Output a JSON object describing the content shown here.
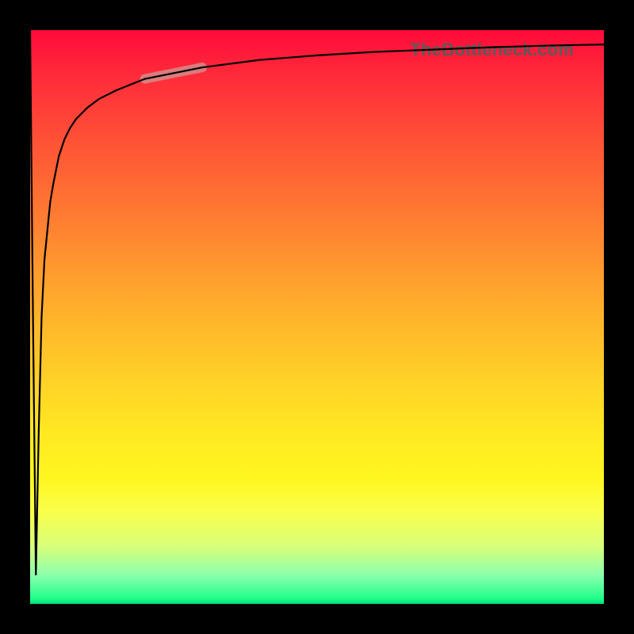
{
  "attribution": "TheBottleneck.com",
  "colors": {
    "frame": "#000000",
    "curve": "#000000",
    "highlight": "#d0948f",
    "gradient_top": "#ff0a3a",
    "gradient_bottom": "#00e076"
  },
  "chart_data": {
    "type": "line",
    "title": "",
    "xlabel": "",
    "ylabel": "",
    "xlim": [
      0,
      100
    ],
    "ylim": [
      0,
      100
    ],
    "x": [
      0,
      0.5,
      1,
      1.5,
      2,
      2.5,
      3,
      3.5,
      4,
      5,
      6,
      7,
      8,
      10,
      12,
      15,
      20,
      25,
      30,
      40,
      50,
      60,
      70,
      80,
      90,
      100
    ],
    "values": [
      100,
      50,
      5,
      30,
      50,
      60,
      65,
      70,
      73,
      78,
      81,
      83,
      84.5,
      86.5,
      88,
      89.5,
      91.5,
      92.5,
      93.5,
      94.8,
      95.6,
      96.2,
      96.6,
      97.0,
      97.3,
      97.5
    ],
    "highlight_range_x": [
      20,
      30
    ]
  }
}
